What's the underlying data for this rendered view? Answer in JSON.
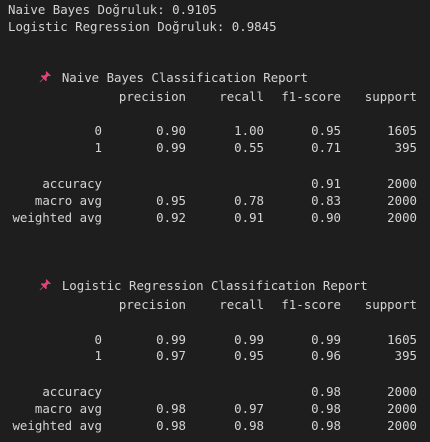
{
  "accuracy_lines": [
    "Naive Bayes Doğruluk: 0.9105",
    "Logistic Regression Doğruluk: 0.9845"
  ],
  "icon": "pushpin-icon",
  "reports": [
    {
      "title": "Naive Bayes Classification Report",
      "headers": [
        "precision",
        "recall",
        "f1-score",
        "support"
      ],
      "rows": [
        {
          "label": "0",
          "precision": "0.90",
          "recall": "1.00",
          "f1": "0.95",
          "support": "1605"
        },
        {
          "label": "1",
          "precision": "0.99",
          "recall": "0.55",
          "f1": "0.71",
          "support": "395"
        }
      ],
      "summary": [
        {
          "label": "accuracy",
          "precision": "",
          "recall": "",
          "f1": "0.91",
          "support": "2000"
        },
        {
          "label": "macro avg",
          "precision": "0.95",
          "recall": "0.78",
          "f1": "0.83",
          "support": "2000"
        },
        {
          "label": "weighted avg",
          "precision": "0.92",
          "recall": "0.91",
          "f1": "0.90",
          "support": "2000"
        }
      ]
    },
    {
      "title": "Logistic Regression Classification Report",
      "headers": [
        "precision",
        "recall",
        "f1-score",
        "support"
      ],
      "rows": [
        {
          "label": "0",
          "precision": "0.99",
          "recall": "0.99",
          "f1": "0.99",
          "support": "1605"
        },
        {
          "label": "1",
          "precision": "0.97",
          "recall": "0.95",
          "f1": "0.96",
          "support": "395"
        }
      ],
      "summary": [
        {
          "label": "accuracy",
          "precision": "",
          "recall": "",
          "f1": "0.98",
          "support": "2000"
        },
        {
          "label": "macro avg",
          "precision": "0.98",
          "recall": "0.97",
          "f1": "0.98",
          "support": "2000"
        },
        {
          "label": "weighted avg",
          "precision": "0.98",
          "recall": "0.98",
          "f1": "0.98",
          "support": "2000"
        }
      ]
    }
  ]
}
